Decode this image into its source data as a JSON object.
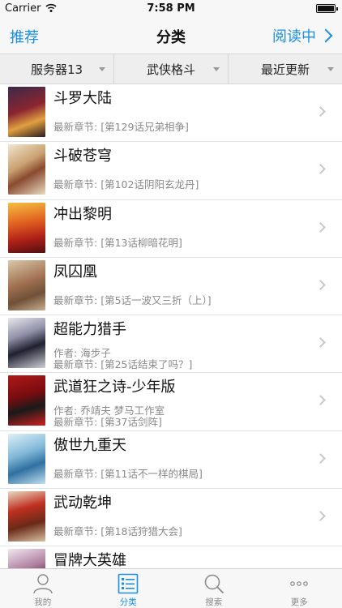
{
  "status": {
    "carrier": "Carrier",
    "time": "7:58 PM"
  },
  "nav": {
    "left": "推荐",
    "title": "分类",
    "right": "阅读中"
  },
  "filters": [
    {
      "label": "服务器13"
    },
    {
      "label": "武侠格斗"
    },
    {
      "label": "最近更新"
    }
  ],
  "latest_prefix": "最新章节:",
  "author_prefix": "作者:",
  "comics": [
    {
      "title": "斗罗大陆",
      "latest": "[第129话兄弟相争]"
    },
    {
      "title": "斗破苍穹",
      "latest": "[第102话阴阳玄龙丹]"
    },
    {
      "title": "冲出黎明",
      "latest": "[第13话柳暗花明]"
    },
    {
      "title": "凤囚凰",
      "latest": "[第5话一波又三折（上）]"
    },
    {
      "title": "超能力猎手",
      "author": "海步子",
      "latest": "[第25话结束了吗？]"
    },
    {
      "title": "武道狂之诗-少年版",
      "author": "乔靖夫 梦马工作室",
      "latest": "[第37话剑阵]"
    },
    {
      "title": "傲世九重天",
      "latest": "[第11话不一样的棋局]"
    },
    {
      "title": "武动乾坤",
      "latest": "[第18话狩猎大会]"
    },
    {
      "title": "冒牌大英雄",
      "latest": ""
    }
  ],
  "tabs": [
    {
      "label": "我的",
      "icon": "person-icon"
    },
    {
      "label": "分类",
      "icon": "list-icon"
    },
    {
      "label": "搜索",
      "icon": "search-icon"
    },
    {
      "label": "更多",
      "icon": "more-icon"
    }
  ],
  "colors": {
    "accent": "#1a8fe8",
    "secondary_text": "#8a8a8a"
  }
}
